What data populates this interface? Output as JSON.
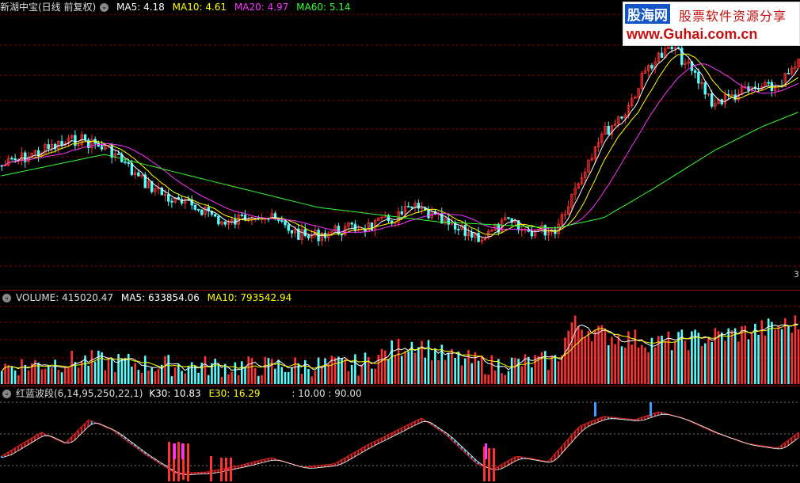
{
  "main_panel": {
    "stock_label": "新湖中宝(日线 前复权)",
    "ma_values": [
      {
        "label": "MA5:",
        "value": "4.18",
        "color": "#ffffff"
      },
      {
        "label": "MA10:",
        "value": "4.61",
        "color": "#ffff00"
      },
      {
        "label": "MA20:",
        "value": "4.97",
        "color": "#ff33ff"
      },
      {
        "label": "MA60:",
        "value": "5.14",
        "color": "#33ff33"
      }
    ],
    "edge_number": "3"
  },
  "volume_panel": {
    "label": "VOLUME:",
    "value": "415020.47",
    "ma5_label": "MA5:",
    "ma5_value": "633854.06",
    "ma10_label": "MA10:",
    "ma10_value": "793542.94"
  },
  "indicator_panel": {
    "label": "红蓝波段(6,14,95,250,22,1)",
    "k_label": "K30:",
    "k_value": "10.83",
    "e_label": "E30:",
    "e_value": "16.29",
    "levels": ": 10.00 : 90.00"
  },
  "watermark": {
    "brand": "股海网",
    "slogan": "股票软件资源分享",
    "url": "www.Guhai.com.cn"
  },
  "colors": {
    "up": "#ff3232",
    "down": "#54ffff",
    "ma5": "#ffffff",
    "ma10": "#ffff00",
    "ma20": "#ff33ff",
    "ma60": "#33ff33",
    "grid": "#8b0000",
    "k_up": "#d02020",
    "k_down": "#3ca0e0",
    "signal": "#ff33ff",
    "top_signal": "#3aa0ff"
  }
}
